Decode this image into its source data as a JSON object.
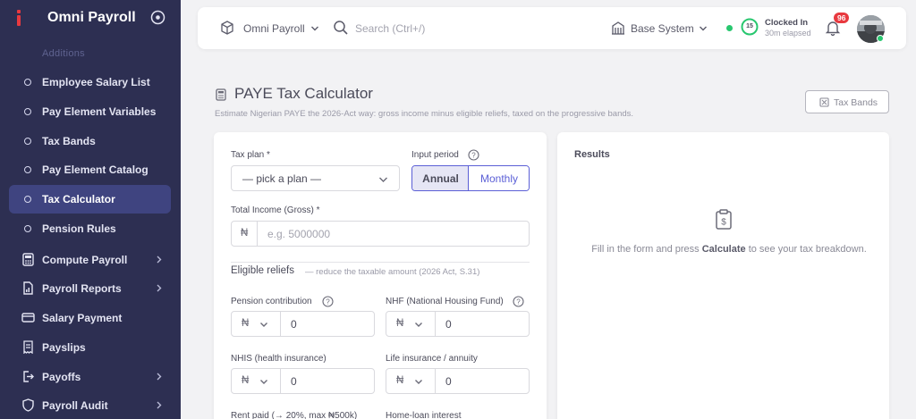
{
  "sidebar": {
    "brand": "Omni Payroll",
    "faded_header": "Additions",
    "items": [
      {
        "label": "Employee Salary List"
      },
      {
        "label": "Pay Element Variables"
      },
      {
        "label": "Tax Bands"
      },
      {
        "label": "Pay Element Catalog"
      },
      {
        "label": "Tax Calculator",
        "active": true
      },
      {
        "label": "Pension Rules"
      },
      {
        "label": "Compute Payroll"
      },
      {
        "label": "Payroll Reports"
      },
      {
        "label": "Salary Payment"
      },
      {
        "label": "Payslips"
      },
      {
        "label": "Payoffs"
      },
      {
        "label": "Payroll Audit"
      }
    ]
  },
  "topbar": {
    "app_selector": "Omni Payroll",
    "search_placeholder": "Search (Ctrl+/)",
    "system_selector": "Base System",
    "clock_title": "Clocked In",
    "clock_sub": "30m elapsed",
    "clock_minutes": "15",
    "notification_count": "96"
  },
  "page": {
    "title": "PAYE Tax Calculator",
    "subtitle": "Estimate Nigerian PAYE the 2026-Act way: gross income minus eligible reliefs, taxed on the progressive bands.",
    "tax_bands_button": "Tax Bands"
  },
  "form": {
    "tax_plan_label": "Tax plan *",
    "tax_plan_value": "— pick a plan —",
    "input_period_label": "Input period",
    "period_annual": "Annual",
    "period_monthly": "Monthly",
    "gross_label": "Total Income (Gross) *",
    "currency": "₦",
    "gross_placeholder": "e.g. 5000000",
    "reliefs_title": "Eligible reliefs",
    "reliefs_note": "— reduce the taxable amount (2026 Act, S.31)",
    "pension_label": "Pension contribution",
    "pension_value": "0",
    "nhf_label": "NHF (National Housing Fund)",
    "nhf_value": "0",
    "nhis_label": "NHIS (health insurance)",
    "nhis_value": "0",
    "life_label": "Life insurance / annuity",
    "life_value": "0",
    "rent_label": "Rent paid (→ 20%, max ₦500k)",
    "home_loan_label": "Home-loan interest"
  },
  "results": {
    "title": "Results",
    "empty_before": "Fill in the form and press ",
    "empty_bold": "Calculate",
    "empty_after": " to see your tax breakdown."
  },
  "colors": {
    "sidebar_bg": "#2d2f52",
    "active_item": "#3f4480",
    "accent": "#5b5fd6",
    "brand_red": "#e8393f",
    "online_green": "#28c76f",
    "badge_red": "#e8393f"
  }
}
